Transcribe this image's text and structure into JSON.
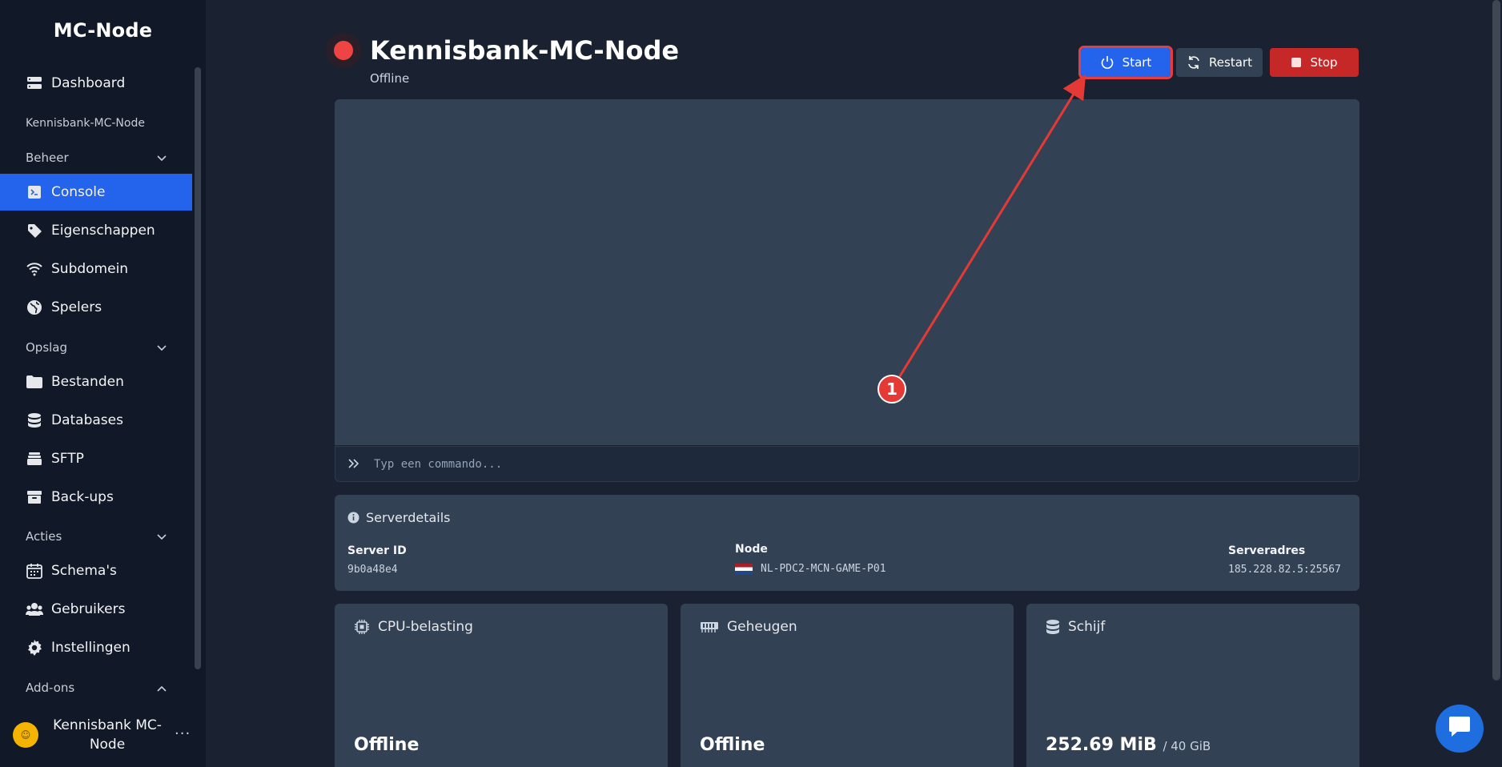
{
  "sidebar": {
    "brand": "MC-Node",
    "dashboard": "Dashboard",
    "server_name": "Kennisbank-MC-Node",
    "sections": {
      "beheer": "Beheer",
      "opslag": "Opslag",
      "acties": "Acties",
      "addons": "Add-ons"
    },
    "items": {
      "console": "Console",
      "eigenschappen": "Eigenschappen",
      "subdomein": "Subdomein",
      "spelers": "Spelers",
      "bestanden": "Bestanden",
      "databases": "Databases",
      "sftp": "SFTP",
      "backups": "Back-ups",
      "schemas": "Schema's",
      "gebruikers": "Gebruikers",
      "instellingen": "Instellingen"
    },
    "user": {
      "name": "Kennisbank MC-Node",
      "more": "···"
    }
  },
  "header": {
    "title": "Kennisbank-MC-Node",
    "status": "Offline"
  },
  "buttons": {
    "start": "Start",
    "restart": "Restart",
    "stop": "Stop"
  },
  "console": {
    "placeholder": "Typ een commando..."
  },
  "details": {
    "heading": "Serverdetails",
    "server_id_label": "Server ID",
    "server_id": "9b0a48e4",
    "node_label": "Node",
    "node": "NL-PDC2-MCN-GAME-P01",
    "address_label": "Serveradres",
    "address": "185.228.82.5:25567"
  },
  "cards": {
    "cpu": {
      "label": "CPU-belasting",
      "value": "Offline"
    },
    "memory": {
      "label": "Geheugen",
      "value": "Offline"
    },
    "disk": {
      "label": "Schijf",
      "value": "252.69 MiB",
      "limit": "/ 40 GiB"
    }
  },
  "annotation": {
    "marker": "1"
  },
  "colors": {
    "accent": "#2463eb",
    "danger": "#c62828",
    "status_offline": "#ef4444",
    "annotation": "#e53935"
  }
}
